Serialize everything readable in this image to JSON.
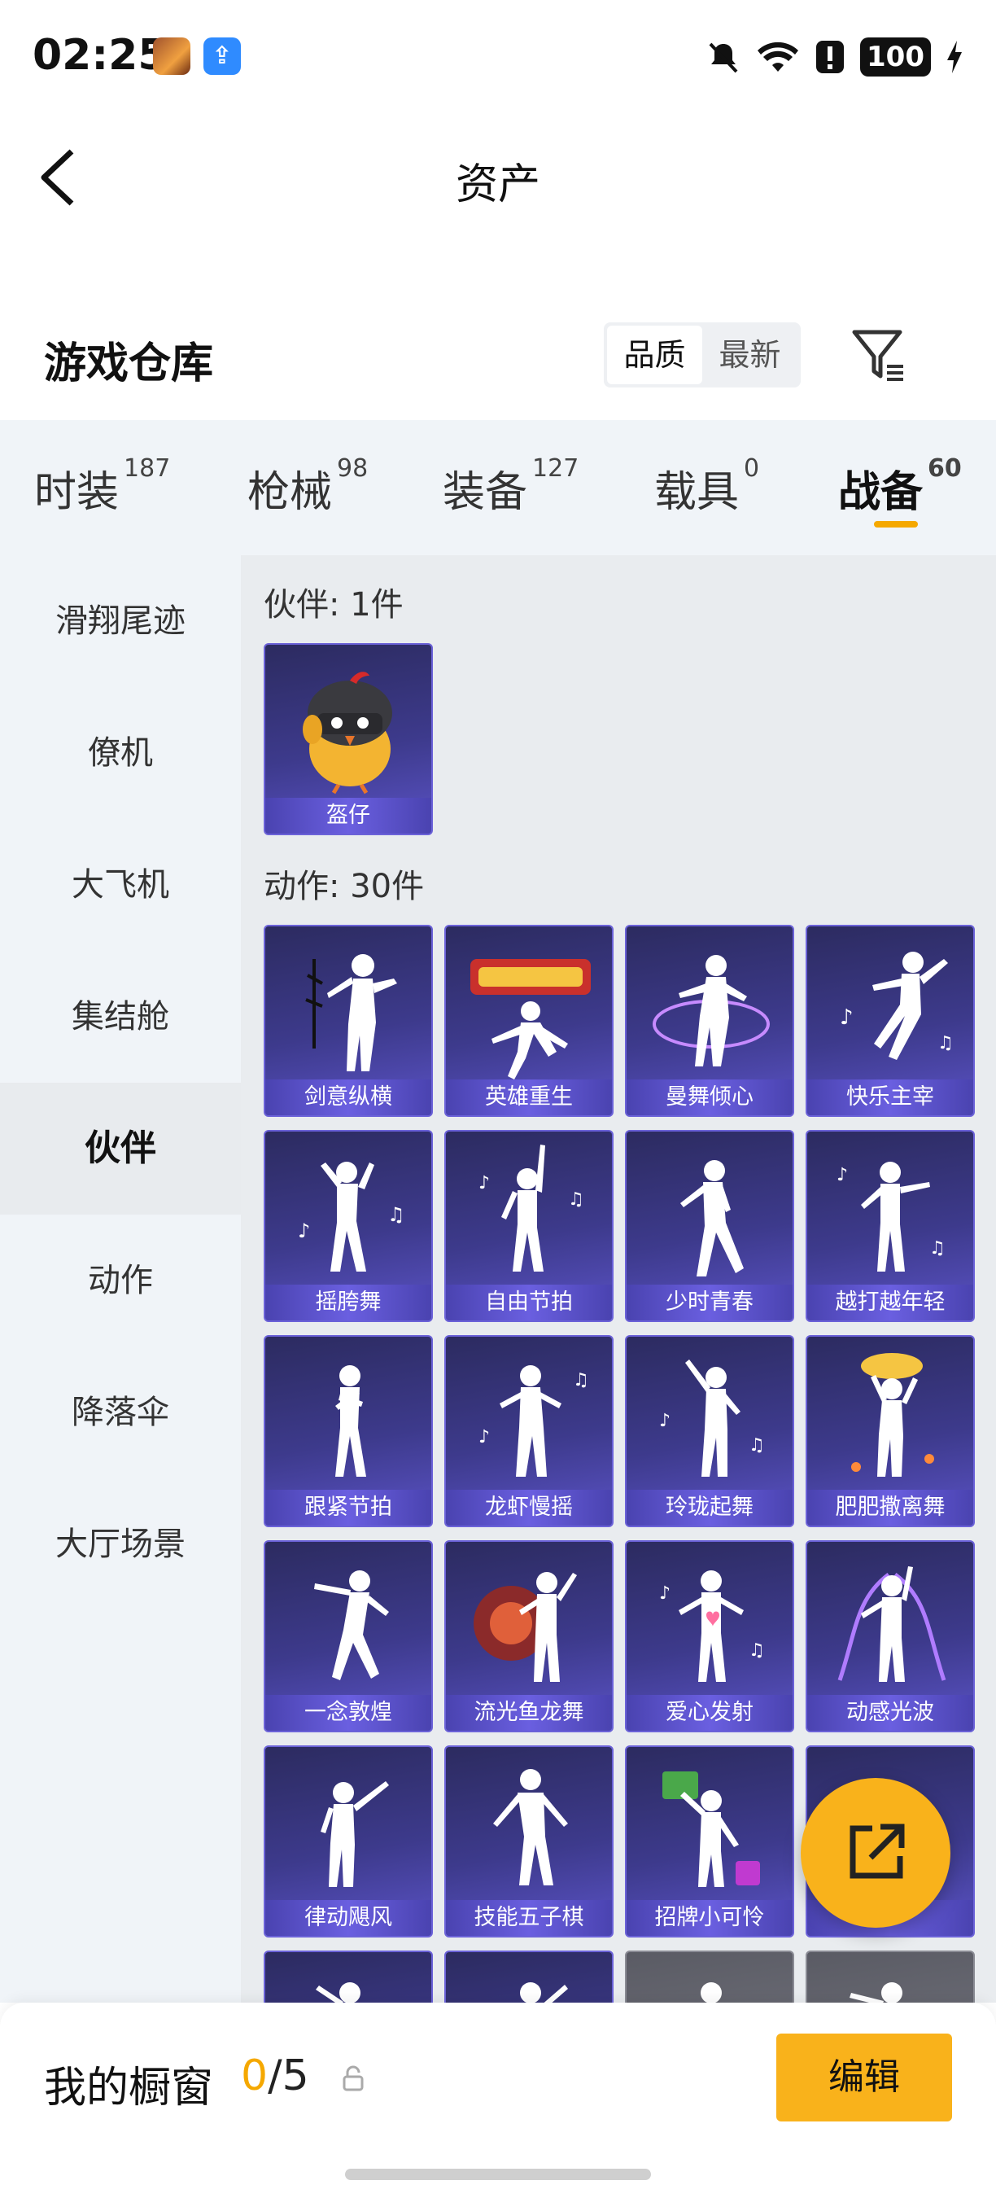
{
  "status_bar": {
    "time": "02:25",
    "battery": "100"
  },
  "header": {
    "title": "资产"
  },
  "section": {
    "title": "游戏仓库",
    "sort_options": [
      "品质",
      "最新"
    ],
    "active_sort": "品质"
  },
  "tabs": [
    {
      "label": "时装",
      "count": "187"
    },
    {
      "label": "枪械",
      "count": "98"
    },
    {
      "label": "装备",
      "count": "127"
    },
    {
      "label": "载具",
      "count": "0"
    },
    {
      "label": "战备",
      "count": "60",
      "active": true
    }
  ],
  "sidebar": [
    "滑翔尾迹",
    "僚机",
    "大飞机",
    "集结舱",
    "伙伴",
    "动作",
    "降落伞",
    "大厅场景"
  ],
  "sidebar_active": "伙伴",
  "groups": [
    {
      "title": "伙伴: 1件",
      "items": [
        "盔仔"
      ]
    },
    {
      "title": "动作: 30件",
      "items": [
        "剑意纵横",
        "英雄重生",
        "曼舞倾心",
        "快乐主宰",
        "摇胯舞",
        "自由节拍",
        "少时青春",
        "越打越年轻",
        "跟紧节拍",
        "龙虾慢摇",
        "玲珑起舞",
        "肥肥撒离舞",
        "一念敦煌",
        "流光鱼龙舞",
        "爱心发射",
        "动感光波",
        "律动飓风",
        "技能五子棋",
        "招牌小可怜",
        "",
        "",
        "",
        "",
        ""
      ]
    }
  ],
  "showcase": {
    "title": "我的橱窗",
    "current": "0",
    "total": "/5",
    "edit_label": "编辑"
  },
  "colors": {
    "accent": "#f9b21b",
    "card_bg": "#3d3a8c",
    "card_label": "#5b53c6"
  }
}
